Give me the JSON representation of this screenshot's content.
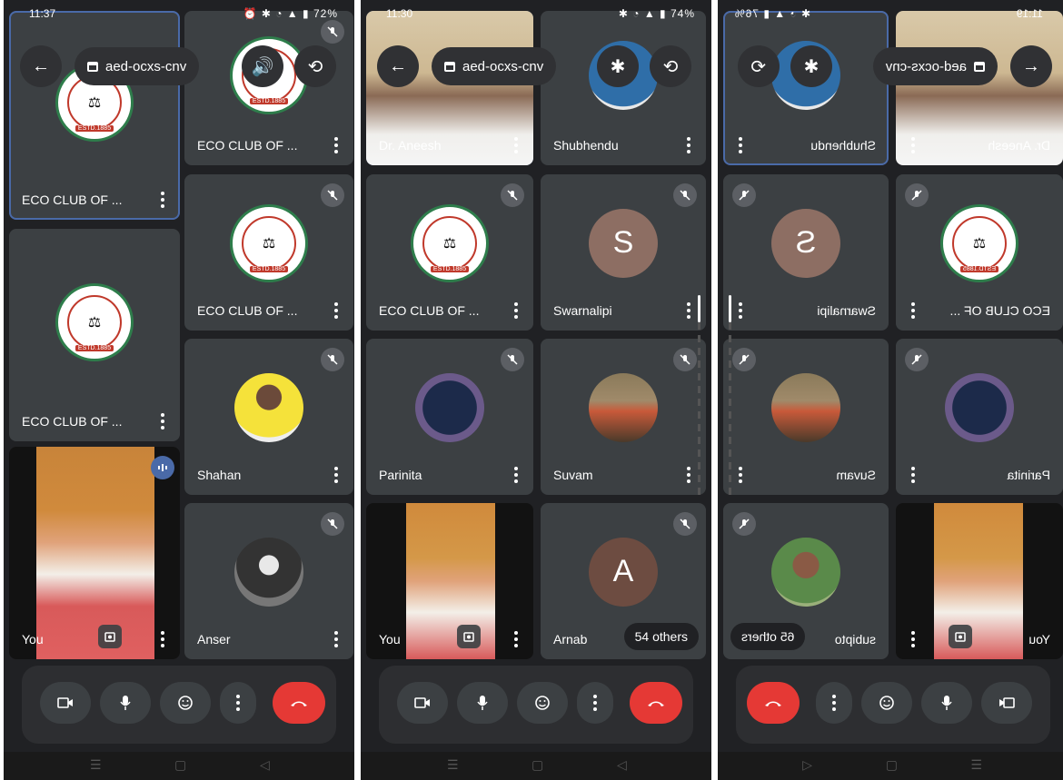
{
  "meeting": {
    "code": "aed-ocxs-cnv"
  },
  "screens": [
    {
      "time": "11:37",
      "battery": "72%",
      "tiles": {
        "t1": "ECO CLUB OF ...",
        "t2": "ECO CLUB OF ...",
        "t3": "ECO CLUB OF ...",
        "t4": "ECO CLUB OF ...",
        "t5": "Shahan",
        "t6": "Anser",
        "self": "You"
      }
    },
    {
      "time": "11:30",
      "battery": "74%",
      "tiles": {
        "t1": "Dr. Aneesh",
        "t2": "Shubhendu",
        "t3": "ECO CLUB OF ...",
        "t4": "Swarnalipi",
        "t5": "Parinita",
        "t6": "Suvam",
        "self": "You",
        "t8": "Arnab"
      },
      "initials": {
        "t4": "S",
        "t8": "A"
      },
      "others_badge": "54 others"
    },
    {
      "time": "11:19",
      "battery": "76%",
      "tiles": {
        "t1": "Dr. Aneesh",
        "t2": "Shubhendu",
        "t3": "ECO CLUB OF ...",
        "t4": "Swarnalipi",
        "t5": "Parinita",
        "t6": "Suvam",
        "self": "You",
        "t8": "subipto"
      },
      "initials": {
        "t4": "S"
      },
      "others_badge": "65 others"
    }
  ],
  "icons": {
    "back": "back-arrow-icon",
    "calendar": "calendar-icon",
    "speaker": "speaker-icon",
    "bluetooth": "bluetooth-icon",
    "switch_camera": "switch-camera-icon",
    "camera": "camera-icon",
    "mic": "mic-icon",
    "emoji": "emoji-icon",
    "more": "more-vert-icon",
    "end_call": "end-call-icon",
    "muted": "mic-off-icon"
  },
  "colors": {
    "end_call": "#e53935",
    "tile": "#3c4043",
    "background": "#202124",
    "active_border": "#4a6aa8"
  }
}
